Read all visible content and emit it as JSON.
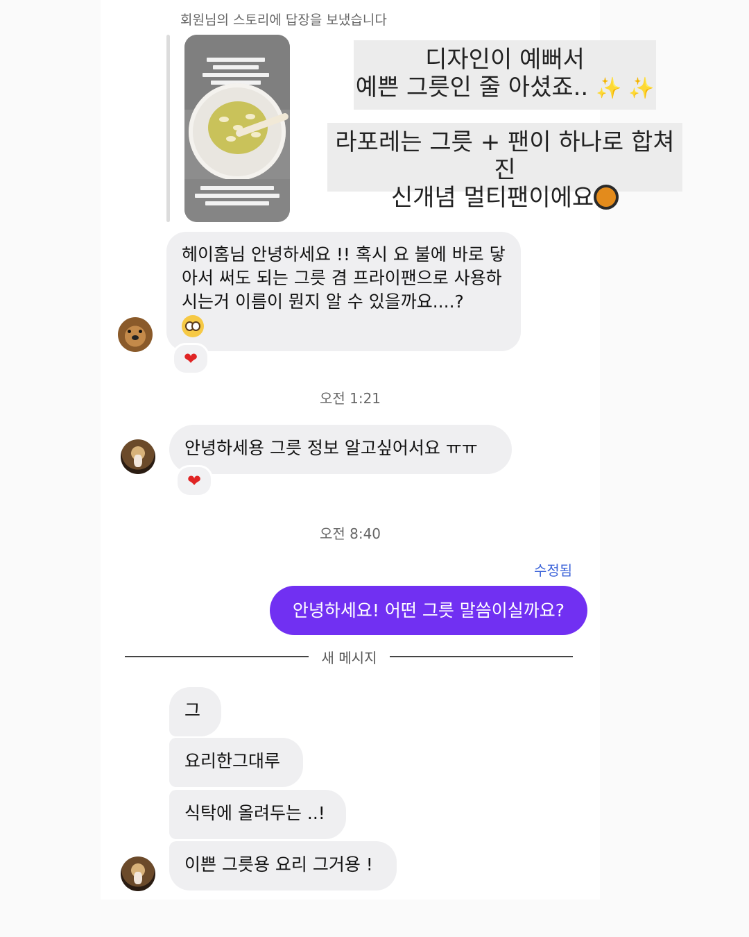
{
  "story": {
    "reply_note": "회원님의 스토리에 답장을 보냈습니다",
    "caption_line1": "디자인이 예뻐서",
    "caption_line2": "예쁜 그릇인 줄 아셨죠..",
    "caption_line3": "라포레는 그릇 + 팬이 하나로 합쳐진",
    "caption_line4": "신개념 멀티팬이에요",
    "sparkle_icons": "✨ ✨",
    "pan_icon": "frying-pan-icon"
  },
  "messages": {
    "first": {
      "text": "헤이홈님 안녕하세요 !! 혹시 요 불에 바로 닿아서 써도 되는 그릇 겸 프라이팬으로 사용하시는거 이름이 뭔지 알 수 있을까요....?",
      "emoji_icon": "pleading-face-icon",
      "reaction": "❤"
    },
    "time1": "오전 1:21",
    "second": {
      "text": "안녕하세용 그릇 정보 알고싶어서요 ㅠㅠ",
      "reaction": "❤"
    },
    "time2": "오전 8:40",
    "edited_label": "수정됨",
    "sent_text": "안녕하세요! 어떤 그릇 말씀이실까요?",
    "new_messages_label": "새 메시지",
    "group": [
      "그",
      "요리한그대루",
      "식탁에 올려두는 ..!",
      "이쁜 그릇용 요리 그거용 !"
    ]
  },
  "colors": {
    "sent_bubble": "#7130f2",
    "received_bubble": "#efeff1",
    "edited_text": "#3b63d9"
  }
}
